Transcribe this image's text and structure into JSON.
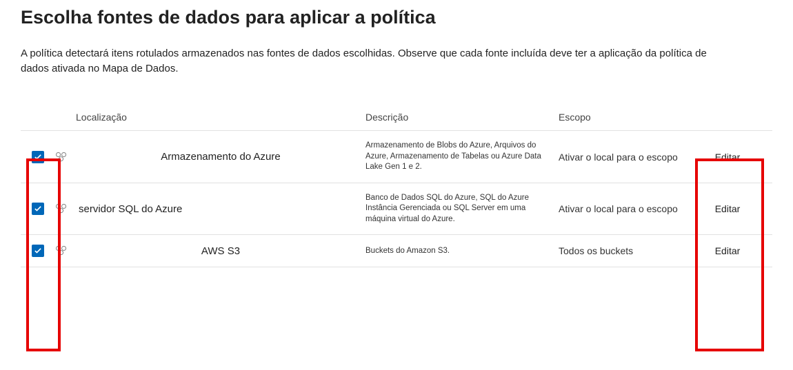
{
  "title": "Escolha fontes de dados para aplicar a política",
  "description": "A política detectará itens rotulados armazenados nas fontes de dados escolhidas. Observe que cada fonte incluída deve ter a aplicação da política de dados ativada no Mapa de Dados.",
  "columns": {
    "location": "Localização",
    "description": "Descrição",
    "scope": "Escopo"
  },
  "edit_label": "Editar",
  "rows": [
    {
      "checked": true,
      "location": "Armazenamento do Azure",
      "loc_align": "center",
      "desc": "Armazenamento de Blobs do Azure, Arquivos do Azure, Armazenamento de Tabelas ou Azure Data Lake Gen 1 e 2.",
      "scope": "Ativar o local para o escopo"
    },
    {
      "checked": true,
      "location": "servidor SQL do Azure",
      "loc_align": "left",
      "desc": "Banco de Dados SQL do Azure, SQL do Azure Instância Gerenciada ou SQL Server em uma máquina virtual do Azure.",
      "scope": "Ativar o local para o escopo"
    },
    {
      "checked": true,
      "location": "AWS S3",
      "loc_align": "center",
      "desc": "Buckets do Amazon S3.",
      "scope": "Todos os buckets"
    }
  ],
  "highlights": {
    "checkbox_column": true,
    "edit_column": true
  }
}
